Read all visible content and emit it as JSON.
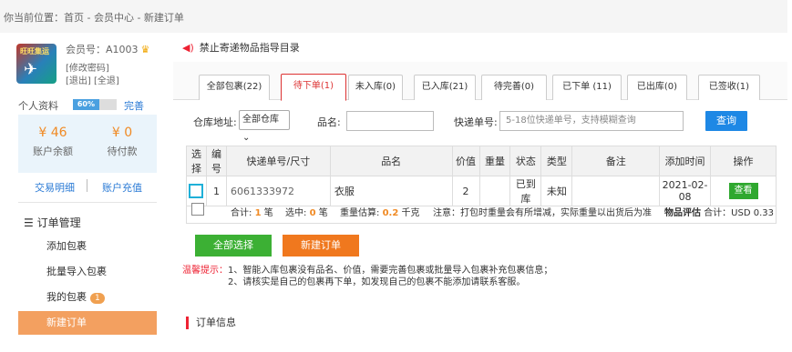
{
  "breadcrumb": "你当前位置：首页 - 会员中心 - 新建订单",
  "user": {
    "logo_text": "旺旺集运",
    "member_label": "会员号：A1003",
    "change_password": "[修改密码]",
    "logout": "[退出]",
    "full_logout": "[全退]"
  },
  "profile": {
    "label": "个人资料",
    "progress_text": "60%",
    "progress": 0.6,
    "complete": "完善"
  },
  "balance": {
    "account_value": "¥ 46",
    "account_label": "账户余额",
    "pending_value": "¥ 0",
    "pending_label": "待付款"
  },
  "quick_links": {
    "transactions": "交易明细",
    "recharge": "账户充值"
  },
  "menu": {
    "title": "订单管理",
    "items": [
      "添加包裹",
      "批量导入包裹",
      "我的包裹",
      "新建订单"
    ],
    "my_packages_count": "1"
  },
  "notice": "禁止寄递物品指导目录",
  "tabs": [
    "全部包裹(22)",
    "待下单(1)",
    "未入库(0)",
    "已入库(21)",
    "待完善(0)",
    "已下单 (11)",
    "已出库(0)",
    "已签收(1)"
  ],
  "filter": {
    "warehouse_label": "仓库地址:",
    "warehouse_value": "全部仓库",
    "name_label": "品名:",
    "tracking_label": "快递单号:",
    "tracking_placeholder": "5-18位快递单号，支持模糊查询",
    "query_button": "查询"
  },
  "table": {
    "headers": [
      "选择",
      "编号",
      "快递单号/尺寸",
      "品名",
      "价值",
      "重量",
      "状态",
      "类型",
      "备注",
      "添加时间",
      "操作"
    ],
    "rows": [
      {
        "no": "1",
        "tracking": "6061333972",
        "name": "衣服",
        "value": "2",
        "weight": "",
        "status": "已到库",
        "type": "未知",
        "remark": "",
        "time": "2021-02-08",
        "action": "查看"
      }
    ]
  },
  "summary": {
    "total_label": "合计:",
    "total_count": "1",
    "unit": "笔",
    "selected_label": "选中:",
    "selected_count": "0",
    "weight_label": "重量估算:",
    "weight_value": "0.2",
    "weight_unit": "千克",
    "note": "注意：打包时重量会有所增减，实际重量以出货后为准",
    "eval_label": "物品评估",
    "eval_total": "合计：USD 0.33"
  },
  "actions": {
    "select_all": "全部选择",
    "new_order": "新建订单"
  },
  "tips": {
    "label": "温馨提示：",
    "line1": "1、智能入库包裹没有品名、价值，需要完善包裹或批量导入包裹补充包裹信息；",
    "line2": "2、请核实是自己的包裹再下单，如发现自己的包裹不能添加请联系客服。"
  },
  "section_title": "订单信息",
  "colors": {
    "accent_orange": "#f08a24",
    "active_menu": "#f3a060",
    "tab_red": "#dd3333",
    "blue": "#1e88e5",
    "green": "#2fa82f"
  }
}
